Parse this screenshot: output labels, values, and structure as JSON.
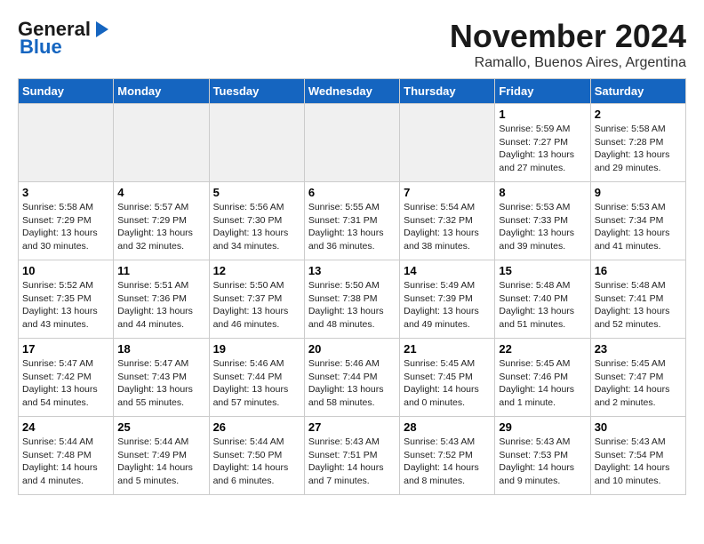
{
  "logo": {
    "part1": "General",
    "part2": "Blue"
  },
  "title": "November 2024",
  "subtitle": "Ramallo, Buenos Aires, Argentina",
  "weekdays": [
    "Sunday",
    "Monday",
    "Tuesday",
    "Wednesday",
    "Thursday",
    "Friday",
    "Saturday"
  ],
  "weeks": [
    [
      {
        "day": "",
        "info": ""
      },
      {
        "day": "",
        "info": ""
      },
      {
        "day": "",
        "info": ""
      },
      {
        "day": "",
        "info": ""
      },
      {
        "day": "",
        "info": ""
      },
      {
        "day": "1",
        "info": "Sunrise: 5:59 AM\nSunset: 7:27 PM\nDaylight: 13 hours\nand 27 minutes."
      },
      {
        "day": "2",
        "info": "Sunrise: 5:58 AM\nSunset: 7:28 PM\nDaylight: 13 hours\nand 29 minutes."
      }
    ],
    [
      {
        "day": "3",
        "info": "Sunrise: 5:58 AM\nSunset: 7:29 PM\nDaylight: 13 hours\nand 30 minutes."
      },
      {
        "day": "4",
        "info": "Sunrise: 5:57 AM\nSunset: 7:29 PM\nDaylight: 13 hours\nand 32 minutes."
      },
      {
        "day": "5",
        "info": "Sunrise: 5:56 AM\nSunset: 7:30 PM\nDaylight: 13 hours\nand 34 minutes."
      },
      {
        "day": "6",
        "info": "Sunrise: 5:55 AM\nSunset: 7:31 PM\nDaylight: 13 hours\nand 36 minutes."
      },
      {
        "day": "7",
        "info": "Sunrise: 5:54 AM\nSunset: 7:32 PM\nDaylight: 13 hours\nand 38 minutes."
      },
      {
        "day": "8",
        "info": "Sunrise: 5:53 AM\nSunset: 7:33 PM\nDaylight: 13 hours\nand 39 minutes."
      },
      {
        "day": "9",
        "info": "Sunrise: 5:53 AM\nSunset: 7:34 PM\nDaylight: 13 hours\nand 41 minutes."
      }
    ],
    [
      {
        "day": "10",
        "info": "Sunrise: 5:52 AM\nSunset: 7:35 PM\nDaylight: 13 hours\nand 43 minutes."
      },
      {
        "day": "11",
        "info": "Sunrise: 5:51 AM\nSunset: 7:36 PM\nDaylight: 13 hours\nand 44 minutes."
      },
      {
        "day": "12",
        "info": "Sunrise: 5:50 AM\nSunset: 7:37 PM\nDaylight: 13 hours\nand 46 minutes."
      },
      {
        "day": "13",
        "info": "Sunrise: 5:50 AM\nSunset: 7:38 PM\nDaylight: 13 hours\nand 48 minutes."
      },
      {
        "day": "14",
        "info": "Sunrise: 5:49 AM\nSunset: 7:39 PM\nDaylight: 13 hours\nand 49 minutes."
      },
      {
        "day": "15",
        "info": "Sunrise: 5:48 AM\nSunset: 7:40 PM\nDaylight: 13 hours\nand 51 minutes."
      },
      {
        "day": "16",
        "info": "Sunrise: 5:48 AM\nSunset: 7:41 PM\nDaylight: 13 hours\nand 52 minutes."
      }
    ],
    [
      {
        "day": "17",
        "info": "Sunrise: 5:47 AM\nSunset: 7:42 PM\nDaylight: 13 hours\nand 54 minutes."
      },
      {
        "day": "18",
        "info": "Sunrise: 5:47 AM\nSunset: 7:43 PM\nDaylight: 13 hours\nand 55 minutes."
      },
      {
        "day": "19",
        "info": "Sunrise: 5:46 AM\nSunset: 7:44 PM\nDaylight: 13 hours\nand 57 minutes."
      },
      {
        "day": "20",
        "info": "Sunrise: 5:46 AM\nSunset: 7:44 PM\nDaylight: 13 hours\nand 58 minutes."
      },
      {
        "day": "21",
        "info": "Sunrise: 5:45 AM\nSunset: 7:45 PM\nDaylight: 14 hours\nand 0 minutes."
      },
      {
        "day": "22",
        "info": "Sunrise: 5:45 AM\nSunset: 7:46 PM\nDaylight: 14 hours\nand 1 minute."
      },
      {
        "day": "23",
        "info": "Sunrise: 5:45 AM\nSunset: 7:47 PM\nDaylight: 14 hours\nand 2 minutes."
      }
    ],
    [
      {
        "day": "24",
        "info": "Sunrise: 5:44 AM\nSunset: 7:48 PM\nDaylight: 14 hours\nand 4 minutes."
      },
      {
        "day": "25",
        "info": "Sunrise: 5:44 AM\nSunset: 7:49 PM\nDaylight: 14 hours\nand 5 minutes."
      },
      {
        "day": "26",
        "info": "Sunrise: 5:44 AM\nSunset: 7:50 PM\nDaylight: 14 hours\nand 6 minutes."
      },
      {
        "day": "27",
        "info": "Sunrise: 5:43 AM\nSunset: 7:51 PM\nDaylight: 14 hours\nand 7 minutes."
      },
      {
        "day": "28",
        "info": "Sunrise: 5:43 AM\nSunset: 7:52 PM\nDaylight: 14 hours\nand 8 minutes."
      },
      {
        "day": "29",
        "info": "Sunrise: 5:43 AM\nSunset: 7:53 PM\nDaylight: 14 hours\nand 9 minutes."
      },
      {
        "day": "30",
        "info": "Sunrise: 5:43 AM\nSunset: 7:54 PM\nDaylight: 14 hours\nand 10 minutes."
      }
    ]
  ]
}
